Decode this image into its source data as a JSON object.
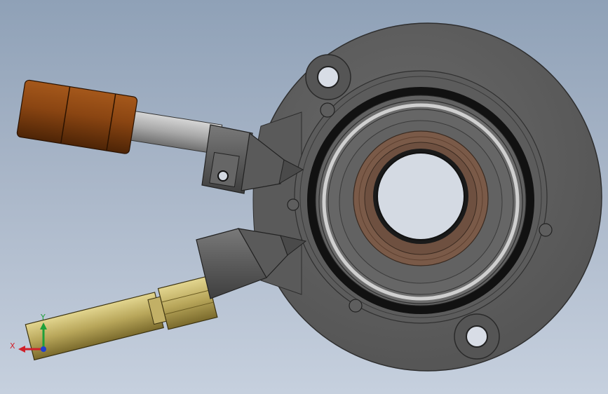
{
  "viewport": {
    "background_top": "#8fa1b7",
    "background_bottom": "#c6d0de"
  },
  "triad": {
    "x_label": "X",
    "y_label": "Y",
    "x_color": "#d0202a",
    "y_color": "#1fa03a",
    "z_color": "#1f3fd0"
  },
  "model": {
    "housing_color": "#5f5f5f",
    "brown_fitting_color": "#8a4512",
    "brass_fitting_color": "#b8a65a",
    "bearing_bronze_color": "#7a5a48"
  }
}
